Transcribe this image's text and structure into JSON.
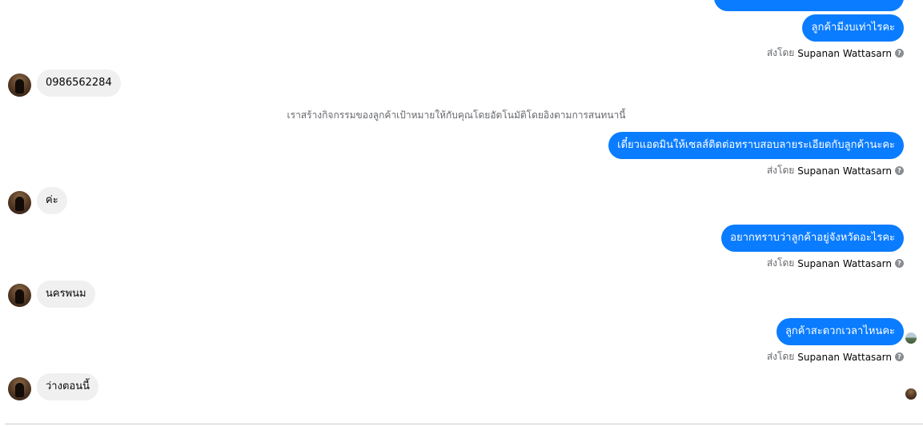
{
  "conversation": {
    "messages": {
      "out_1": "ลูกค้ามีงบเท่าไรคะ",
      "in_1": "0986562284",
      "out_2": "เดี๋ยวแอดมินให้เซลส์ติดต่อทราบสอบลายระเอียดกับลูกค้านะคะ",
      "in_2": "ค่ะ",
      "out_3": "อยากทราบว่าลูกค้าอยู่จังหวัดอะไรคะ",
      "in_3": "นครพนม",
      "out_4": "ลูกค้าสะดวกเวลาไหนคะ",
      "in_4": "ว่างตอนนี้"
    },
    "sent_by_prefix": "ส่งโดย",
    "sender_name": "Supanan Wattasarn",
    "info_glyph": "?",
    "system_note": "เราสร้างกิจกรรมของลูกค้าเป้าหมายให้กับคุณโดยอัตโนมัติโดยอิงตามการสนทนานี้"
  }
}
